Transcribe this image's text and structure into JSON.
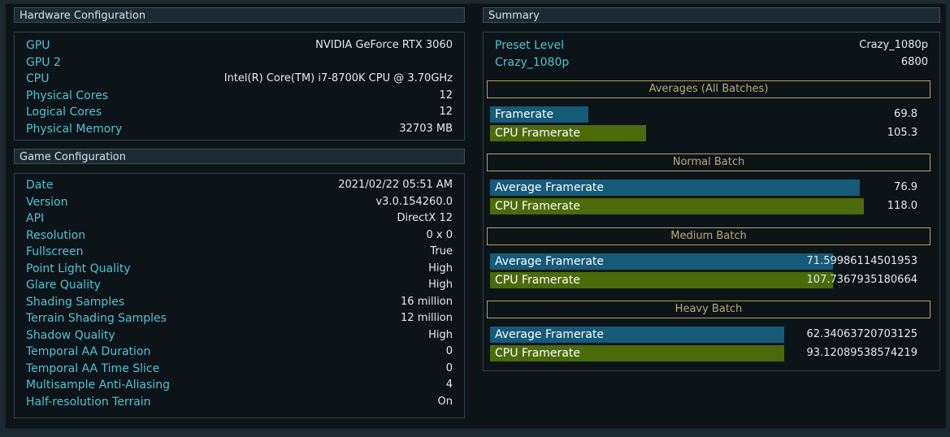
{
  "hardware": {
    "title": "Hardware Configuration",
    "rows": [
      {
        "label": "GPU",
        "value": "NVIDIA GeForce RTX 3060"
      },
      {
        "label": "GPU 2",
        "value": ""
      },
      {
        "label": "CPU",
        "value": "Intel(R) Core(TM) i7-8700K CPU @ 3.70GHz"
      },
      {
        "label": "Physical Cores",
        "value": "12"
      },
      {
        "label": "Logical Cores",
        "value": "12"
      },
      {
        "label": "Physical Memory",
        "value": "32703 MB"
      }
    ]
  },
  "game": {
    "title": "Game Configuration",
    "rows": [
      {
        "label": "Date",
        "value": "2021/02/22 05:51 AM"
      },
      {
        "label": "Version",
        "value": "v3.0.154260.0"
      },
      {
        "label": "API",
        "value": "DirectX 12"
      },
      {
        "label": "Resolution",
        "value": "0 x 0"
      },
      {
        "label": "Fullscreen",
        "value": "True"
      },
      {
        "label": "Point Light Quality",
        "value": "High"
      },
      {
        "label": "Glare Quality",
        "value": "High"
      },
      {
        "label": "Shading Samples",
        "value": "16 million"
      },
      {
        "label": "Terrain Shading Samples",
        "value": "12 million"
      },
      {
        "label": "Shadow Quality",
        "value": "High"
      },
      {
        "label": "Temporal AA Duration",
        "value": "0"
      },
      {
        "label": "Temporal AA Time Slice",
        "value": "0"
      },
      {
        "label": "Multisample Anti-Aliasing",
        "value": "4"
      },
      {
        "label": "Half-resolution Terrain",
        "value": "On"
      }
    ]
  },
  "summary": {
    "title": "Summary",
    "rows": [
      {
        "label": "Preset Level",
        "value": "Crazy_1080p"
      },
      {
        "label": "Crazy_1080p",
        "value": "6800"
      }
    ],
    "sections": [
      {
        "title": "Averages (All Batches)",
        "bars": [
          {
            "label": "Framerate",
            "value": "69.8",
            "fraction": 0.22,
            "color": "blue"
          },
          {
            "label": "CPU Framerate",
            "value": "105.3",
            "fraction": 0.35,
            "color": "green"
          }
        ]
      },
      {
        "title": "Normal Batch",
        "bars": [
          {
            "label": "Average Framerate",
            "value": "76.9",
            "fraction": 0.83,
            "color": "blue"
          },
          {
            "label": "CPU Framerate",
            "value": "118.0",
            "fraction": 0.84,
            "color": "green"
          }
        ]
      },
      {
        "title": "Medium Batch",
        "bars": [
          {
            "label": "Average Framerate",
            "value": "71.59986114501953",
            "fraction": 0.77,
            "color": "blue"
          },
          {
            "label": "CPU Framerate",
            "value": "107.7367935180664",
            "fraction": 0.77,
            "color": "green"
          }
        ]
      },
      {
        "title": "Heavy Batch",
        "bars": [
          {
            "label": "Average Framerate",
            "value": "62.34063720703125",
            "fraction": 0.66,
            "color": "blue"
          },
          {
            "label": "CPU Framerate",
            "value": "93.12089538574219",
            "fraction": 0.66,
            "color": "green"
          }
        ]
      }
    ]
  },
  "colors": {
    "label_cyan": "#4fc3d8",
    "bar_blue": "#155a78",
    "bar_green": "#4b6a0a",
    "section_gold": "#b5a46a"
  }
}
